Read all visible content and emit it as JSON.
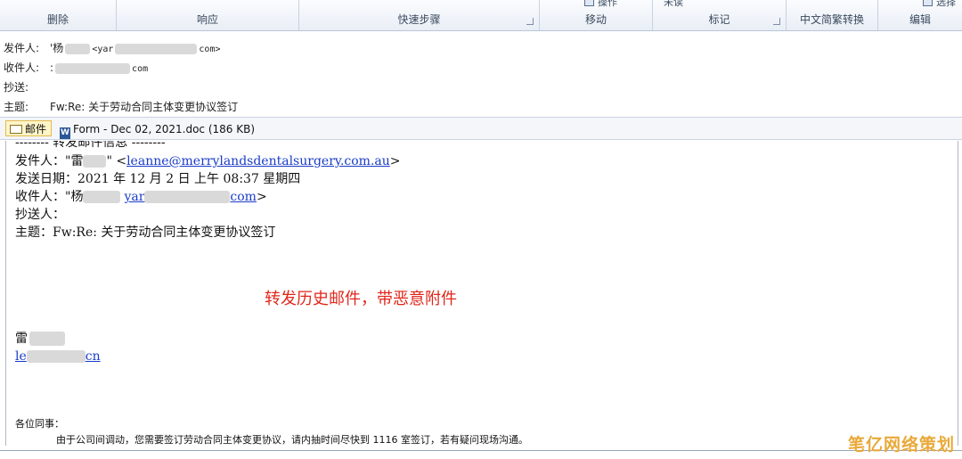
{
  "ribbon": {
    "groups": [
      {
        "label": "删除"
      },
      {
        "label": "响应"
      },
      {
        "label": "快速步骤"
      },
      {
        "label": "移动",
        "peek": "操作"
      },
      {
        "label": "标记",
        "peek": "未读"
      },
      {
        "label": "中文简繁转换"
      },
      {
        "label": "编辑",
        "peek": "选择"
      }
    ]
  },
  "header": {
    "from_label": "发件人:",
    "from_value_start": "'杨",
    "from_value_end": "com>",
    "from_email_start": "<yar",
    "to_label": "收件人:",
    "to_value_start": ":",
    "to_value_end": "com",
    "cc_label": "抄送:",
    "subject_label": "主题:",
    "subject_value": "Fw:Re: 关于劳动合同主体变更协议签订"
  },
  "attachments": {
    "mail_tab": "邮件",
    "doc_tab": "Form - Dec 02, 2021.doc (186 KB)"
  },
  "body": {
    "fwd_header": "-------- 转发邮件信息 --------",
    "from_line_start": "发件人：\"雷",
    "from_line_quote": "\" <",
    "from_line_email": "leanne@merrylandsdentalsurgery.com.au",
    "from_line_end": ">",
    "date_line": "发送日期：2021 年 12 月 2 日 上午 08:37 星期四",
    "to_line_start": "收件人：\"杨",
    "to_line_email_start": "yar",
    "to_line_email_end": "com",
    "to_line_end": ">",
    "cc_line": "抄送人：",
    "subject_line": "主题：Fw:Re: 关于劳动合同主体变更协议签订",
    "annotation": "转发历史邮件，带恶意附件",
    "sig_name": "雷",
    "sig_link_start": "le",
    "sig_link_end": "cn",
    "greeting": "各位同事：",
    "message": "由于公司间调动，您需要签订劳动合同主体变更协议，请内抽时间尽快到 1116 室签订，若有疑问现场沟通。"
  },
  "watermark": "笔亿网络策划",
  "colors": {
    "annotation": "#e0261b",
    "link": "#1a3cc8",
    "watermark": "#e9a93a"
  }
}
